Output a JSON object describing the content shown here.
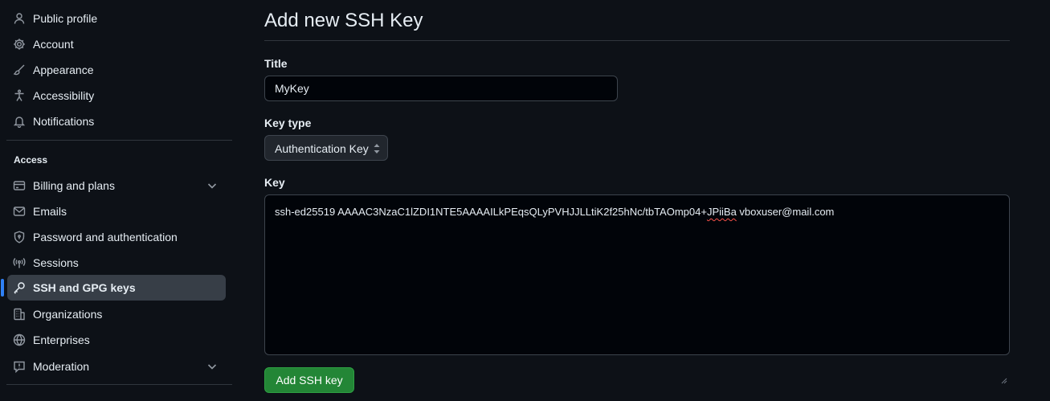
{
  "sidebar": {
    "items": [
      {
        "label": "Public profile",
        "icon": "person-icon"
      },
      {
        "label": "Account",
        "icon": "gear-icon"
      },
      {
        "label": "Appearance",
        "icon": "paintbrush-icon"
      },
      {
        "label": "Accessibility",
        "icon": "accessibility-icon"
      },
      {
        "label": "Notifications",
        "icon": "bell-icon"
      }
    ],
    "access_heading": "Access",
    "access_items": [
      {
        "label": "Billing and plans",
        "icon": "credit-card-icon",
        "expandable": true
      },
      {
        "label": "Emails",
        "icon": "mail-icon"
      },
      {
        "label": "Password and authentication",
        "icon": "shield-lock-icon"
      },
      {
        "label": "Sessions",
        "icon": "broadcast-icon"
      },
      {
        "label": "SSH and GPG keys",
        "icon": "key-icon",
        "active": true
      },
      {
        "label": "Organizations",
        "icon": "organization-icon"
      },
      {
        "label": "Enterprises",
        "icon": "globe-icon"
      },
      {
        "label": "Moderation",
        "icon": "report-icon",
        "expandable": true
      }
    ]
  },
  "main": {
    "title": "Add new SSH Key",
    "title_field": {
      "label": "Title",
      "value": "MyKey"
    },
    "key_type_field": {
      "label": "Key type",
      "selected": "Authentication Key"
    },
    "key_field": {
      "label": "Key",
      "value_before": "ssh-ed25519 AAAAC3NzaC1lZDI1NTE5AAAAILkPEqsQLyPVHJJLLtiK2f25hNc/tbTAOmp04+",
      "value_misspelled": "JPiiBa",
      "value_after": " vboxuser@mail.com"
    },
    "submit_label": "Add SSH key"
  },
  "colors": {
    "background": "#0d1117",
    "input_background": "#010409",
    "border": "#3d444d",
    "active_item": "#373e47",
    "active_indicator": "#2f81f7",
    "primary_button": "#238636",
    "text": "#e6edf3"
  }
}
